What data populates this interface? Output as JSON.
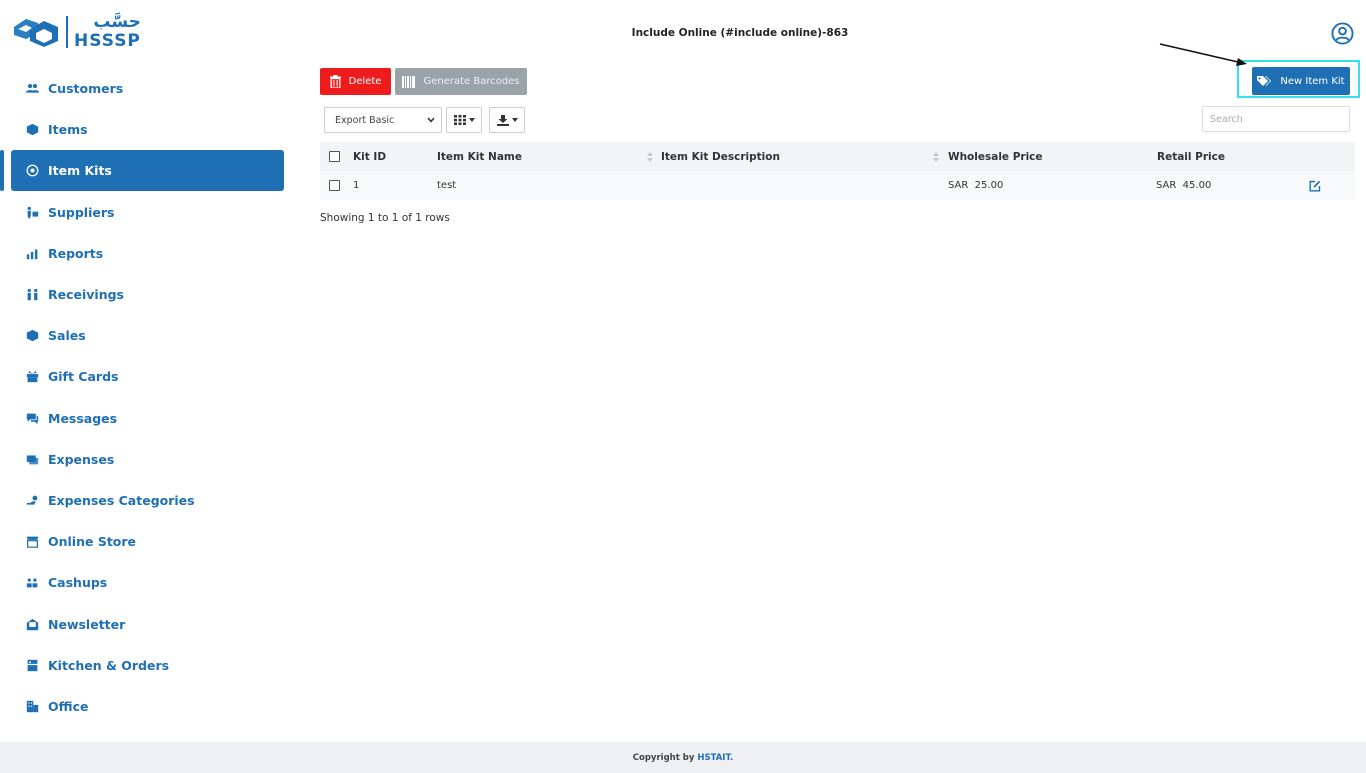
{
  "logo": {
    "arabic_text": "حسَّب",
    "english_text": "HSSSP"
  },
  "header": {
    "title": "Include Online (#include online)-863"
  },
  "sidebar": {
    "items": [
      {
        "label": "Customers",
        "icon": "users-icon"
      },
      {
        "label": "Items",
        "icon": "box-icon"
      },
      {
        "label": "Item Kits",
        "icon": "kit-icon",
        "active": true
      },
      {
        "label": "Suppliers",
        "icon": "supplier-icon"
      },
      {
        "label": "Reports",
        "icon": "chart-icon"
      },
      {
        "label": "Receivings",
        "icon": "receiving-icon"
      },
      {
        "label": "Sales",
        "icon": "sales-icon"
      },
      {
        "label": "Gift Cards",
        "icon": "gift-icon"
      },
      {
        "label": "Messages",
        "icon": "message-icon"
      },
      {
        "label": "Expenses",
        "icon": "expenses-icon"
      },
      {
        "label": "Expenses Categories",
        "icon": "expense-categories-icon"
      },
      {
        "label": "Online Store",
        "icon": "store-icon"
      },
      {
        "label": "Cashups",
        "icon": "cashups-icon"
      },
      {
        "label": "Newsletter",
        "icon": "newsletter-icon"
      },
      {
        "label": "Kitchen & Orders",
        "icon": "kitchen-icon"
      },
      {
        "label": "Office",
        "icon": "office-icon"
      }
    ]
  },
  "toolbar": {
    "delete_label": "Delete",
    "generate_barcodes_label": "Generate Barcodes",
    "new_item_kit_label": "New Item Kit",
    "export_select_value": "Export Basic",
    "search_placeholder": "Search"
  },
  "table": {
    "columns": [
      "Kit ID",
      "Item Kit Name",
      "Item Kit Description",
      "Wholesale Price",
      "Retail Price"
    ],
    "rows": [
      {
        "kit_id": "1",
        "name": "test",
        "description": "",
        "wholesale_price": "SAR  25.00",
        "retail_price": "SAR  45.00"
      }
    ],
    "pagination_text": "Showing 1 to 1 of 1 rows"
  },
  "footer": {
    "prefix": "Copyright by",
    "brand": "HSTAIT."
  },
  "colors": {
    "primary": "#1f6fb5",
    "danger": "#ee1c1c",
    "muted_button": "#9aa3a8",
    "highlight": "#35e0f0"
  }
}
